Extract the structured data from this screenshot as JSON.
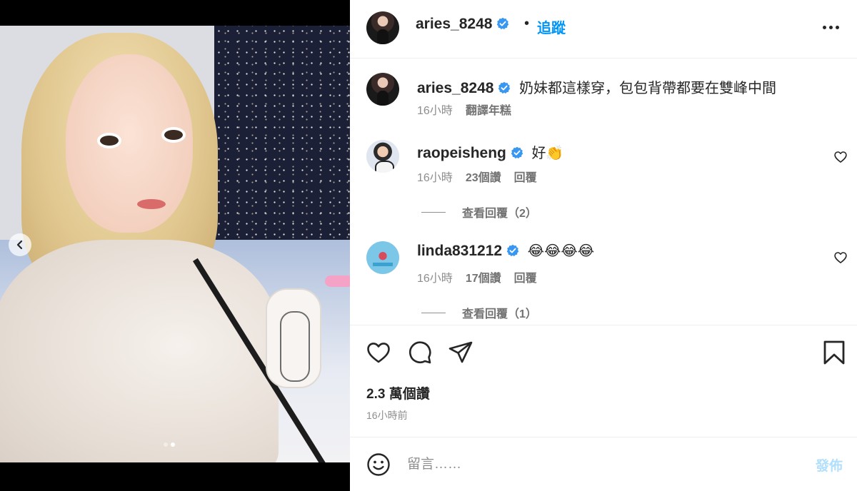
{
  "post": {
    "username": "aries_8248",
    "follow_label": "追蹤",
    "separator": "•"
  },
  "caption": {
    "username": "aries_8248",
    "text": "奶妹都這樣穿，包包背帶都要在雙峰中間",
    "time": "16小時",
    "translate": "翻譯年糕"
  },
  "comments": [
    {
      "username": "raopeisheng",
      "text": "好👏",
      "time": "16小時",
      "likes": "23個讚",
      "reply": "回覆",
      "view_replies": "查看回覆（2）"
    },
    {
      "username": "linda831212",
      "text": "😂😂😂😂",
      "time": "16小時",
      "likes": "17個讚",
      "reply": "回覆",
      "view_replies": "查看回覆（1）"
    }
  ],
  "stats": {
    "likes": "2.3 萬個讚",
    "time": "16小時前"
  },
  "composer": {
    "placeholder": "留言……",
    "post_label": "發佈"
  },
  "carousel": {
    "slide_count": 2,
    "active_index": 1
  },
  "colors": {
    "link": "#0095f6",
    "post_disabled": "#b2dffc",
    "verified": "#3897f0",
    "muted": "#8e8e8e"
  },
  "icons": [
    "verified-badge-icon",
    "more-options-icon",
    "heart-icon",
    "comment-icon",
    "share-icon",
    "bookmark-icon",
    "emoji-icon",
    "chevron-left-icon"
  ]
}
